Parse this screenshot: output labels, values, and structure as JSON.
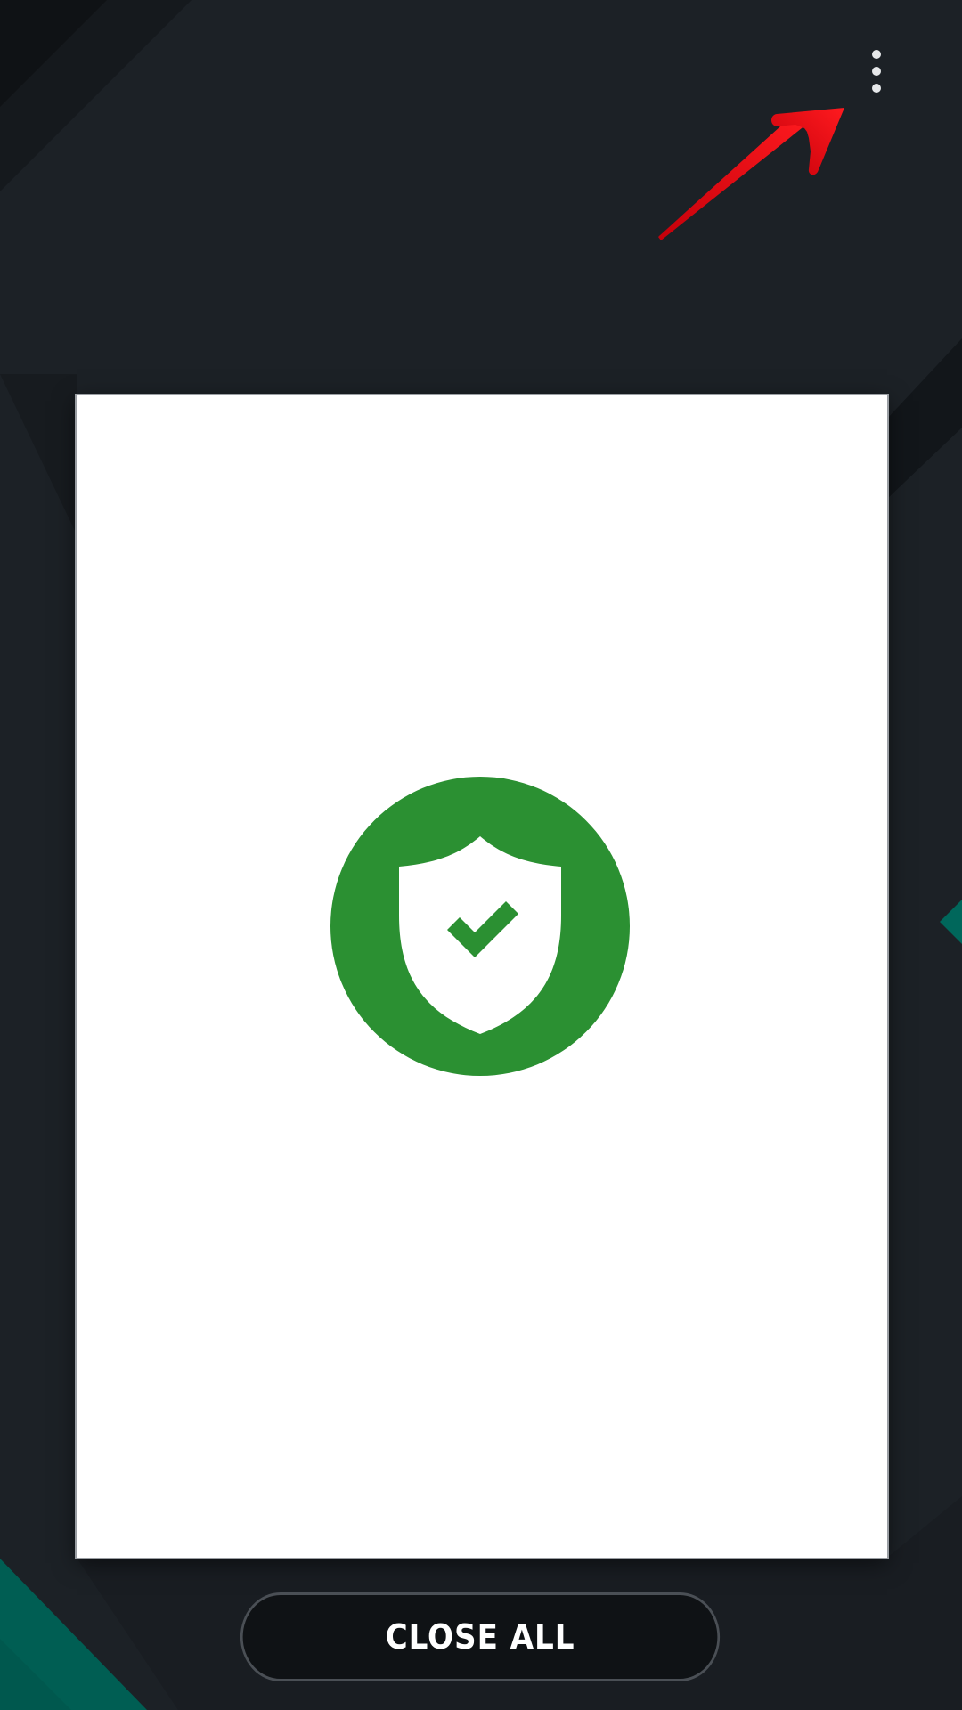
{
  "recents": {
    "close_all_label": "CLOSE ALL"
  },
  "icons": {
    "overflow_menu": "more-vertical-icon",
    "app_icon": "shield-check-icon",
    "annotation": "red-arrow-icon"
  },
  "colors": {
    "background": "#1c2126",
    "accent_teal": "#006a5e",
    "app_green": "#2b9032",
    "annotation_red": "#e8000d",
    "card_background": "#ffffff"
  }
}
